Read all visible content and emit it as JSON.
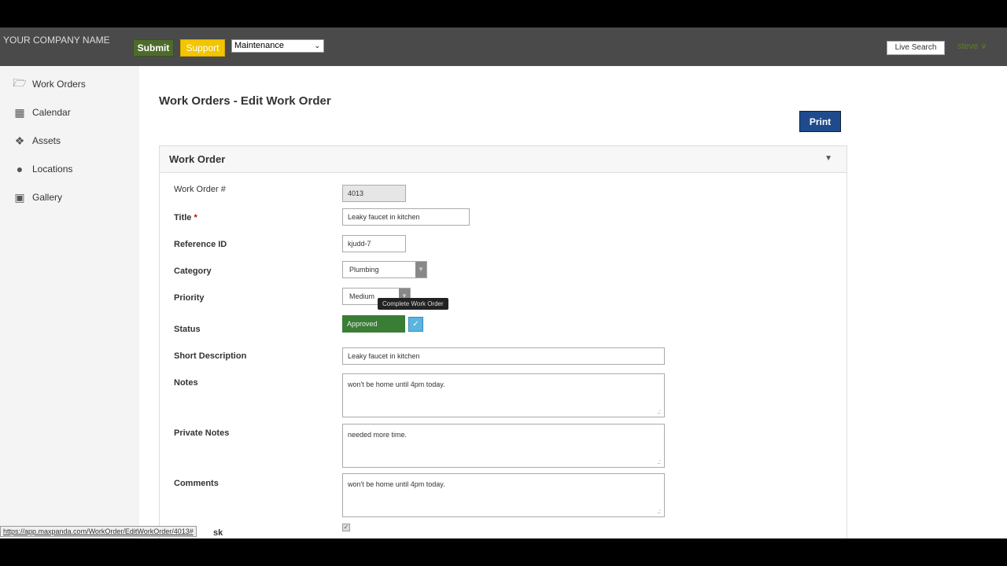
{
  "header": {
    "company": "YOUR COMPANY NAME",
    "submit": "Submit",
    "support": "Support",
    "module_select": "Maintenance",
    "live_search": "Live Search",
    "user": "steve"
  },
  "sidebar": {
    "items": [
      {
        "label": "Work Orders",
        "icon": "folder-open-icon"
      },
      {
        "label": "Calendar",
        "icon": "calendar-icon"
      },
      {
        "label": "Assets",
        "icon": "tags-icon"
      },
      {
        "label": "Locations",
        "icon": "map-marker-icon"
      },
      {
        "label": "Gallery",
        "icon": "image-icon"
      }
    ]
  },
  "page": {
    "title": "Work Orders - Edit Work Order",
    "print": "Print"
  },
  "panel": {
    "title": "Work Order"
  },
  "form": {
    "work_order_label": "Work Order #",
    "work_order": "4013",
    "title_label": "Title",
    "title_required": "*",
    "title": "Leaky faucet in kitchen",
    "reference_label": "Reference ID",
    "reference": "kjudd-7",
    "category_label": "Category",
    "category": "Plumbing",
    "priority_label": "Priority",
    "priority": "Medium",
    "status_label": "Status",
    "status": "Approved",
    "status_color": "#3a7d35",
    "complete_tooltip": "Complete Work Order",
    "short_desc_label": "Short Description",
    "short_desc": "Leaky faucet in kitchen",
    "notes_label": "Notes",
    "notes": "won't be home until 4pm today.",
    "private_notes_label": "Private Notes",
    "private_notes": "needed more time.",
    "comments_label": "Comments",
    "comments": "won't be home until 4pm today.",
    "partial_label": "sk"
  },
  "browser_status": {
    "url": "https://app.maxpanda.com/WorkOrder/EditWorkOrder/4013#"
  }
}
